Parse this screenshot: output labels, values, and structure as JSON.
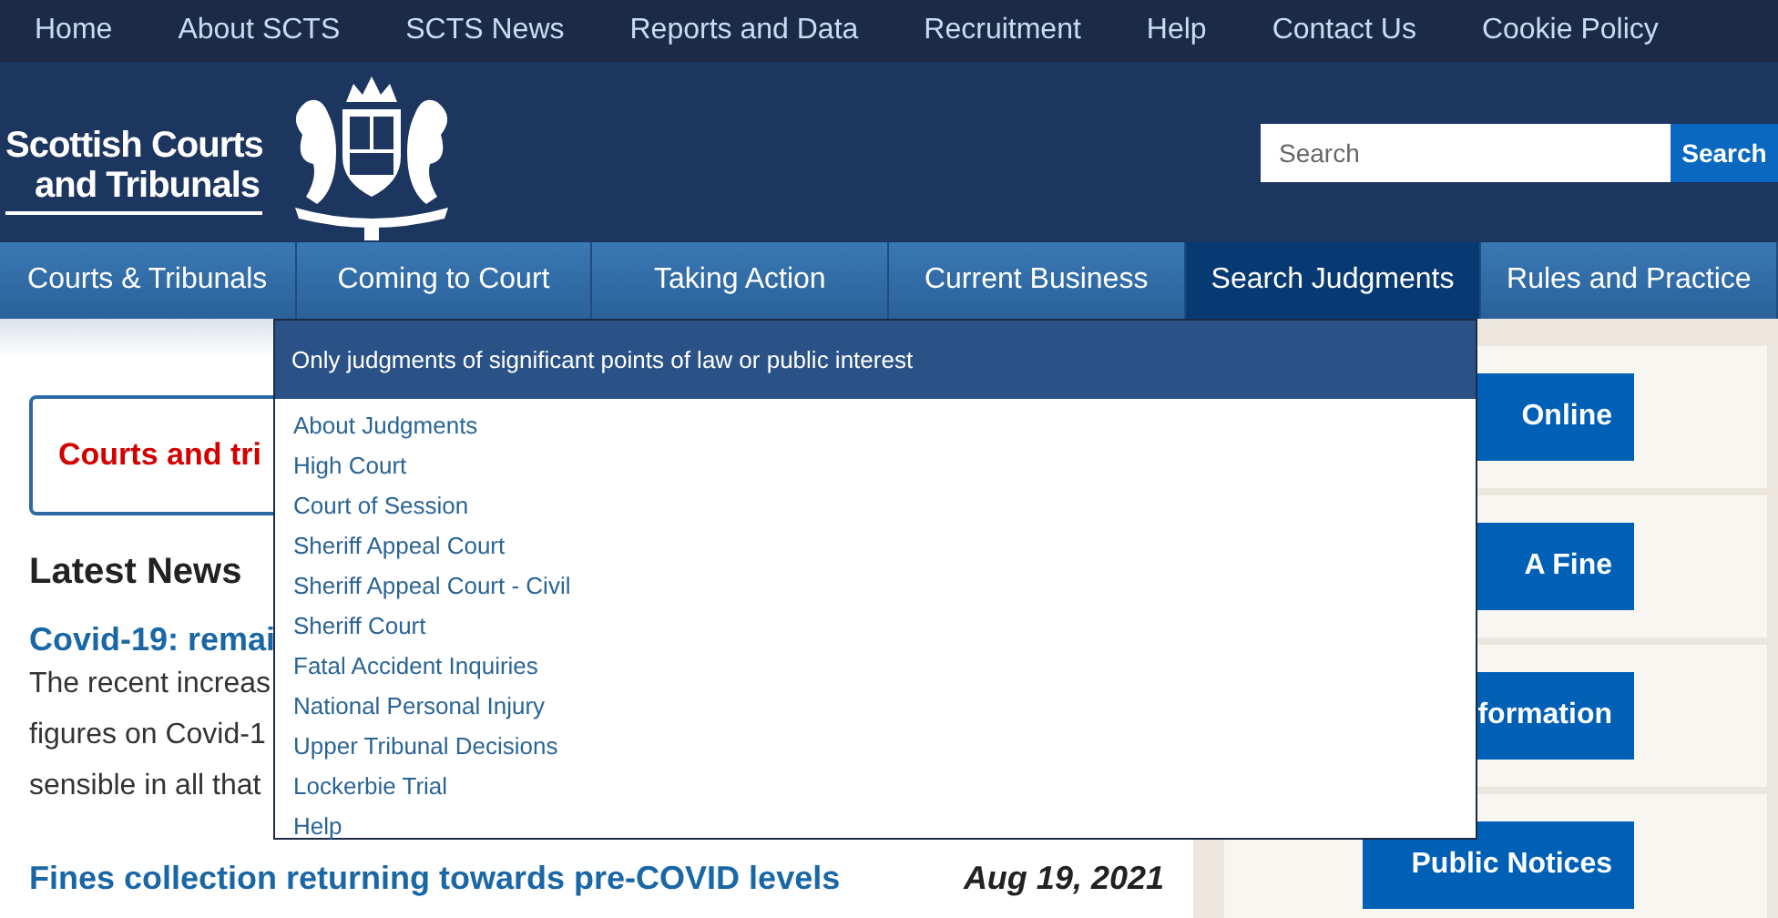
{
  "top_nav": [
    "Home",
    "About SCTS",
    "SCTS News",
    "Reports and Data",
    "Recruitment",
    "Help",
    "Contact Us",
    "Cookie Policy"
  ],
  "logo": {
    "lines": [
      "Scottish Courts",
      "and Tribunals"
    ]
  },
  "search": {
    "placeholder": "Search",
    "button": "Search"
  },
  "main_nav": [
    {
      "label": "Courts & Tribunals",
      "selected": false
    },
    {
      "label": "Coming to Court",
      "selected": false
    },
    {
      "label": "Taking Action",
      "selected": false
    },
    {
      "label": "Current Business",
      "selected": false
    },
    {
      "label": "Search Judgments",
      "selected": true
    },
    {
      "label": "Rules and Practice",
      "selected": false
    }
  ],
  "dropdown": {
    "header": "Only judgments of significant points of law or public interest",
    "items": [
      "About Judgments",
      "High Court",
      "Court of Session",
      "Sheriff Appeal Court",
      "Sheriff Appeal Court - Civil",
      "Sheriff Court",
      "Fatal Accident Inquiries",
      "National Personal Injury",
      "Upper Tribunal Decisions",
      "Lockerbie Trial",
      "Help"
    ]
  },
  "alert": "Courts and tri",
  "latest_news": {
    "heading": "Latest News",
    "articles": [
      {
        "title": "Covid-19: remai",
        "body_lines": [
          "The recent increas",
          "figures on Covid-1",
          "sensible in all that"
        ]
      },
      {
        "title": "Fines collection returning towards pre-COVID levels",
        "date": "Aug 19, 2021"
      }
    ]
  },
  "sidebar_buttons": [
    "Online",
    "A Fine",
    "formation",
    "Public Notices"
  ]
}
